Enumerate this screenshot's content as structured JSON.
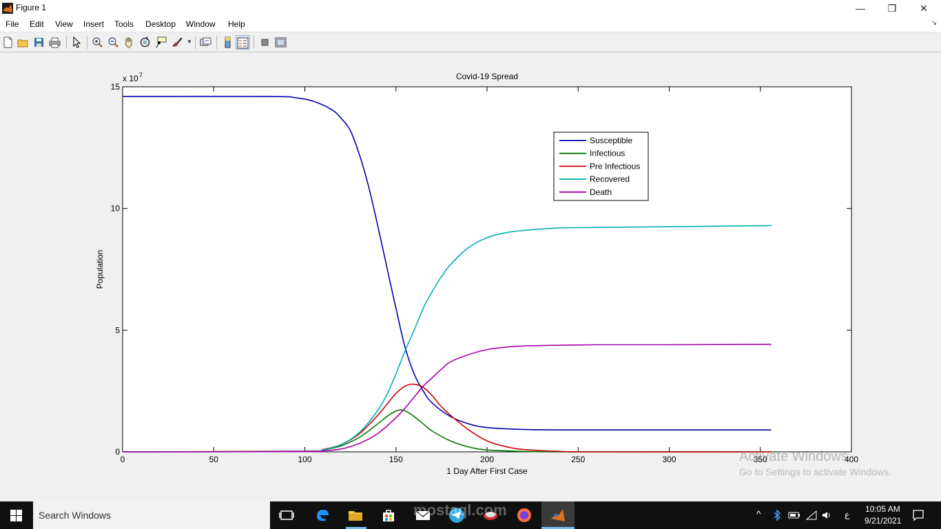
{
  "window": {
    "title": "Figure 1",
    "controls": {
      "minimize": "—",
      "restore": "❐",
      "close": "✕"
    }
  },
  "menu": [
    "File",
    "Edit",
    "View",
    "Insert",
    "Tools",
    "Desktop",
    "Window",
    "Help"
  ],
  "toolbar_icons": [
    "new-figure-icon",
    "open-file-icon",
    "save-icon",
    "print-icon",
    "edit-plot-icon",
    "zoom-in-icon",
    "zoom-out-icon",
    "pan-icon",
    "rotate-3d-icon",
    "data-cursor-icon",
    "brush-icon",
    "link-plot-icon",
    "insert-colorbar-icon",
    "insert-legend-icon",
    "hide-plot-tools-icon",
    "show-plot-tools-icon"
  ],
  "chart_data": {
    "type": "line",
    "title": "Covid-19 Spread",
    "xlabel": "1 Day After First Case",
    "ylabel": "Population",
    "y_multiplier_label": "x 10",
    "y_multiplier_exponent": "7",
    "xlim": [
      0,
      400
    ],
    "ylim": [
      0,
      15
    ],
    "xticks": [
      0,
      50,
      100,
      150,
      200,
      250,
      300,
      350,
      400
    ],
    "yticks": [
      0,
      5,
      10,
      15
    ],
    "grid": false,
    "legend_position": "top-right",
    "series": [
      {
        "name": "Susceptible",
        "color": "#0000aa",
        "x": [
          0,
          80,
          95,
          105,
          115,
          120,
          125,
          130,
          135,
          140,
          145,
          150,
          155,
          160,
          165,
          170,
          180,
          190,
          200,
          220,
          250,
          300,
          356
        ],
        "y": [
          14.6,
          14.6,
          14.55,
          14.4,
          14.05,
          13.7,
          13.2,
          12.2,
          10.9,
          9.3,
          7.6,
          5.9,
          4.3,
          3.2,
          2.5,
          2.0,
          1.45,
          1.15,
          1.0,
          0.92,
          0.9,
          0.9,
          0.9
        ]
      },
      {
        "name": "Infectious",
        "color": "#007700",
        "x": [
          0,
          100,
          110,
          120,
          130,
          140,
          145,
          150,
          153,
          156,
          160,
          165,
          170,
          180,
          190,
          200,
          220,
          250,
          356
        ],
        "y": [
          0,
          0.02,
          0.08,
          0.25,
          0.6,
          1.15,
          1.45,
          1.68,
          1.72,
          1.65,
          1.45,
          1.15,
          0.85,
          0.45,
          0.2,
          0.08,
          0.02,
          0,
          0
        ]
      },
      {
        "name": "Pre Infectious",
        "color": "#cc0000",
        "x": [
          0,
          100,
          110,
          120,
          130,
          140,
          145,
          150,
          155,
          160,
          165,
          170,
          175,
          180,
          190,
          200,
          210,
          220,
          240,
          260,
          356
        ],
        "y": [
          0,
          0.03,
          0.1,
          0.3,
          0.75,
          1.5,
          1.95,
          2.4,
          2.7,
          2.78,
          2.65,
          2.3,
          1.85,
          1.5,
          0.9,
          0.45,
          0.22,
          0.1,
          0.02,
          0,
          0
        ]
      },
      {
        "name": "Recovered",
        "color": "#00b0b0",
        "x": [
          0,
          100,
          110,
          120,
          130,
          140,
          145,
          150,
          155,
          160,
          165,
          170,
          175,
          180,
          190,
          200,
          210,
          220,
          240,
          260,
          300,
          356
        ],
        "y": [
          0,
          0.02,
          0.08,
          0.3,
          0.8,
          1.7,
          2.35,
          3.2,
          4.15,
          5.0,
          5.9,
          6.6,
          7.2,
          7.7,
          8.4,
          8.8,
          9.0,
          9.1,
          9.2,
          9.22,
          9.25,
          9.3
        ]
      },
      {
        "name": "Death",
        "color": "#aa00aa",
        "x": [
          0,
          100,
          110,
          120,
          130,
          140,
          150,
          155,
          160,
          165,
          170,
          175,
          180,
          190,
          200,
          210,
          220,
          240,
          260,
          300,
          356
        ],
        "y": [
          0,
          0.01,
          0.04,
          0.12,
          0.35,
          0.75,
          1.4,
          1.8,
          2.25,
          2.7,
          3.05,
          3.4,
          3.7,
          4.0,
          4.2,
          4.3,
          4.35,
          4.38,
          4.4,
          4.4,
          4.42
        ]
      }
    ]
  },
  "overlay": {
    "activate_title": "Activate Windows",
    "activate_sub": "Go to Settings to activate Windows.",
    "watermark": "mostaql.com"
  },
  "taskbar": {
    "search_placeholder": "Search Windows",
    "time": "10:05 AM",
    "date": "9/21/2021",
    "lang": "ع"
  }
}
